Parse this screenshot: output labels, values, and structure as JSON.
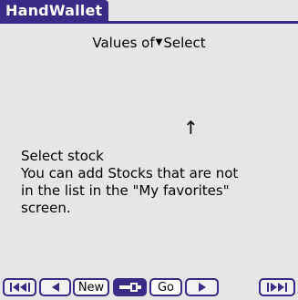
{
  "app": {
    "title": "HandWallet"
  },
  "selector": {
    "label": "Values of",
    "arrow_icon": "triangle-down-icon",
    "value": "Select"
  },
  "hint": {
    "arrow_icon": "up-arrow-icon",
    "arrow_glyph": "↑",
    "heading": "Select stock",
    "lines": [
      "You can add Stocks that are not",
      "in the list in the \"My favorites\"",
      "screen."
    ]
  },
  "toolbar": {
    "buttons": [
      {
        "name": "first-button",
        "icon": "first-page-icon"
      },
      {
        "name": "prev-button",
        "icon": "previous-icon"
      },
      {
        "name": "new-button",
        "label": "New"
      },
      {
        "name": "key-button",
        "icon": "key-icon",
        "active": true
      },
      {
        "name": "go-button",
        "label": "Go"
      },
      {
        "name": "next-button",
        "icon": "next-icon"
      },
      {
        "name": "last-button",
        "icon": "last-page-icon"
      }
    ]
  },
  "colors": {
    "accent": "#3a2b86",
    "background": "#e6e6e6",
    "text": "#000000"
  }
}
